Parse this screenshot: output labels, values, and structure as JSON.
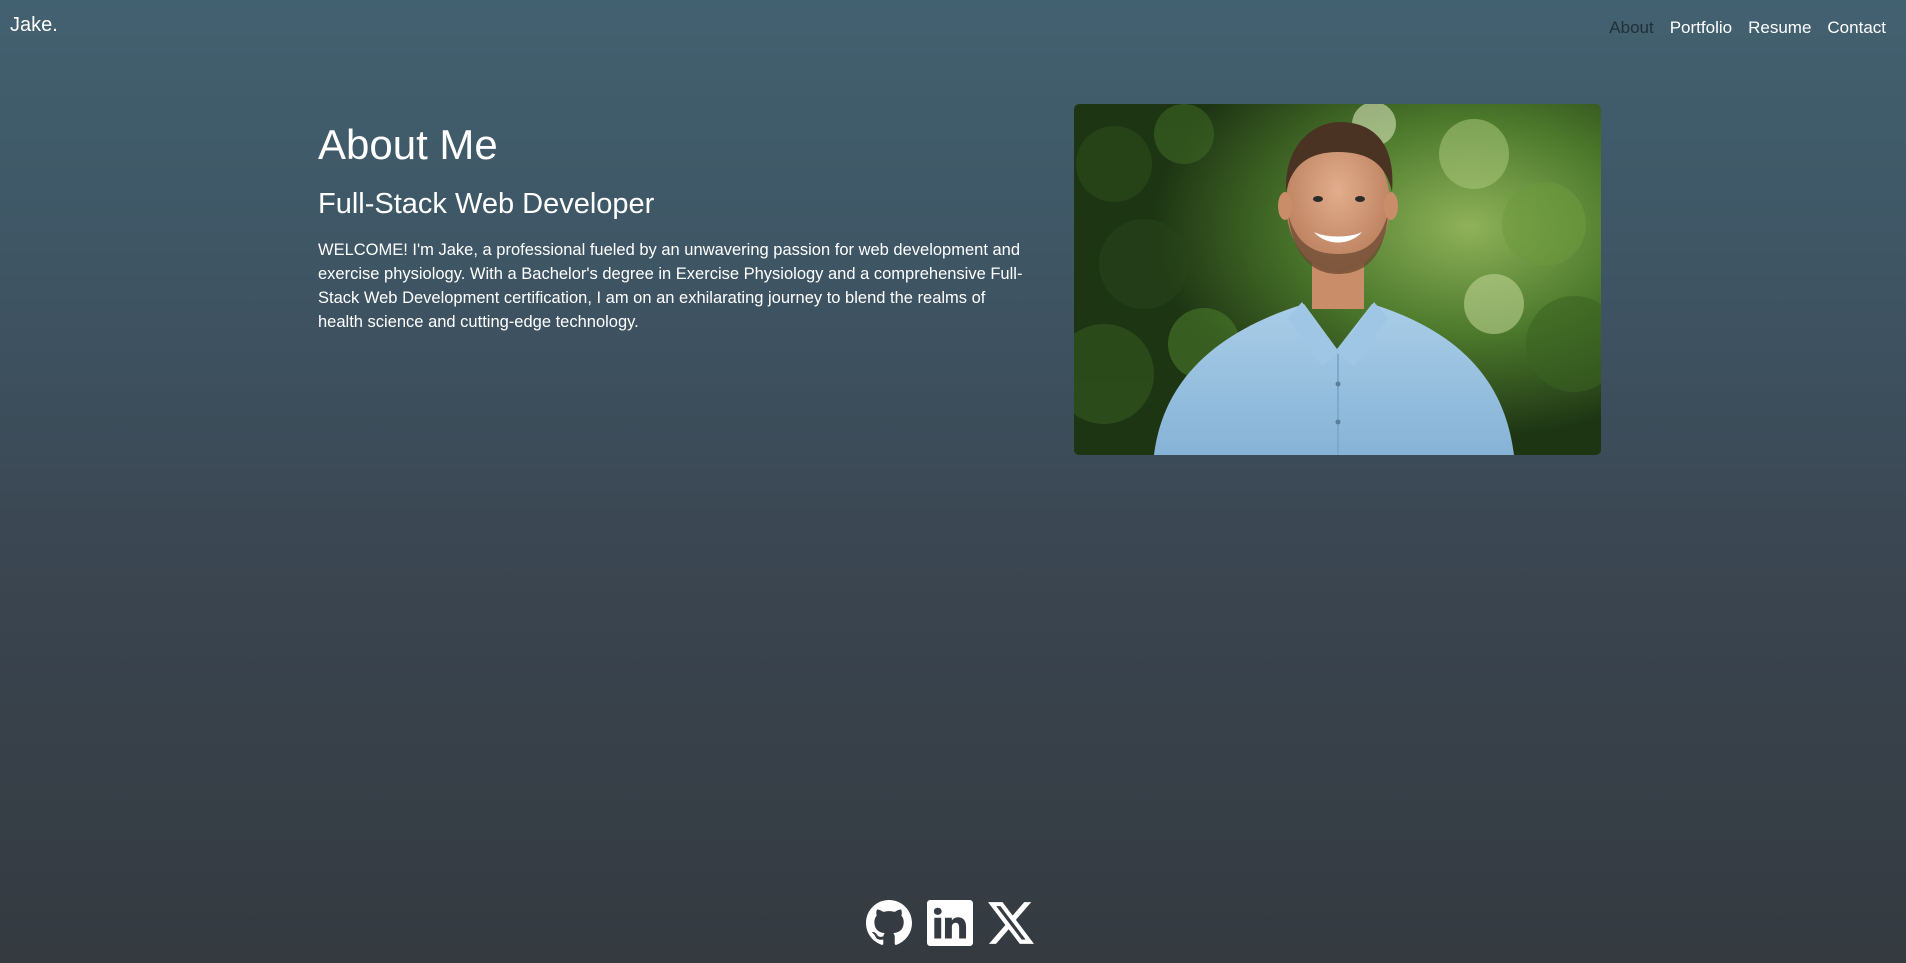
{
  "brand": "Jake.",
  "nav": {
    "items": [
      {
        "label": "About",
        "active": true
      },
      {
        "label": "Portfolio",
        "active": false
      },
      {
        "label": "Resume",
        "active": false
      },
      {
        "label": "Contact",
        "active": false
      }
    ]
  },
  "about": {
    "title": "About Me",
    "subtitle": "Full-Stack Web Developer",
    "body": "WELCOME! I'm Jake, a professional fueled by an unwavering passion for web development and exercise physiology. With a Bachelor's degree in Exercise Physiology and a comprehensive Full-Stack Web Development certification, I am on an exhilarating journey to blend the realms of health science and cutting-edge technology."
  },
  "socials": {
    "icons": [
      "github-icon",
      "linkedin-icon",
      "x-icon"
    ]
  },
  "colors": {
    "gradient_top": "#426170",
    "gradient_bottom": "#343a40",
    "text": "#ffffff",
    "active_nav": "rgba(0,0,0,0.5)"
  }
}
